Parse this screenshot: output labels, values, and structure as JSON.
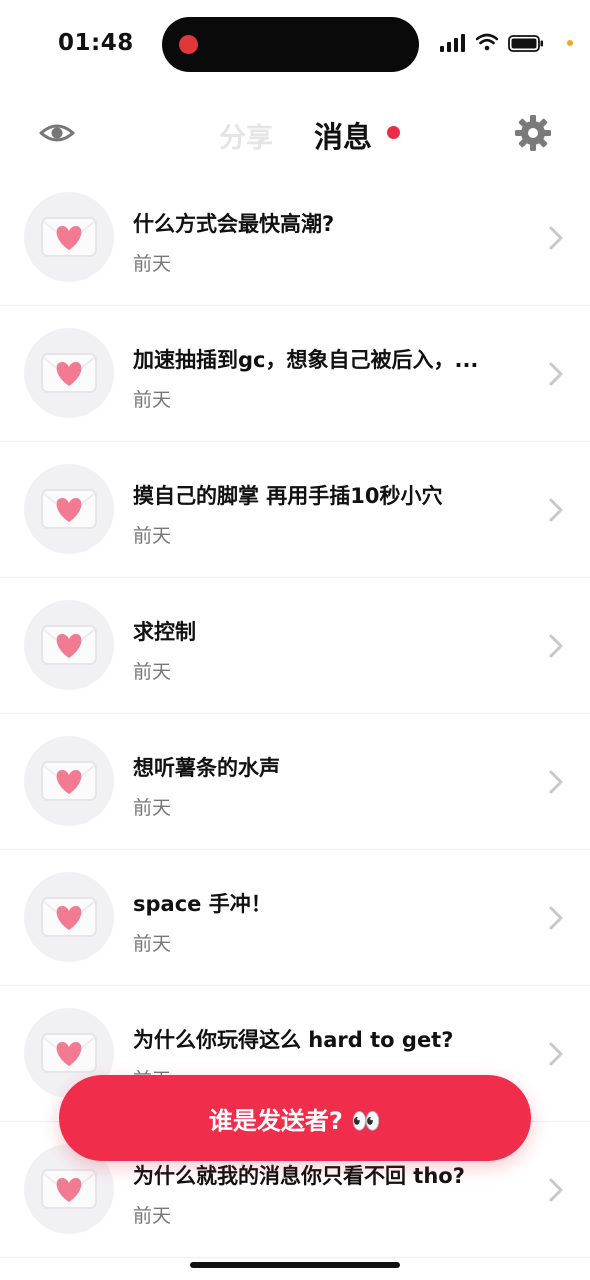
{
  "status_bar": {
    "time": "01:48"
  },
  "header": {
    "tabs": [
      {
        "label": "分享"
      },
      {
        "label": "消息"
      }
    ],
    "icons": {
      "left": "eye-icon",
      "right": "gear-icon"
    },
    "accent_color": "#ee2b47"
  },
  "messages": [
    {
      "title": "什么方式会最快高潮?",
      "time": "前天"
    },
    {
      "title": "加速抽插到gc，想象自己被后入，...",
      "time": "前天"
    },
    {
      "title": "摸自己的脚掌 再用手插10秒小穴",
      "time": "前天"
    },
    {
      "title": "求控制",
      "time": "前天"
    },
    {
      "title": "想听薯条的水声",
      "time": "前天"
    },
    {
      "title": "space 手冲！",
      "time": "前天"
    },
    {
      "title": "为什么你玩得这么 hard to get?",
      "time": "前天"
    },
    {
      "title": "为什么就我的消息你只看不回 tho?",
      "time": "前天"
    }
  ],
  "cta": {
    "label": "谁是发送者? 👀"
  }
}
